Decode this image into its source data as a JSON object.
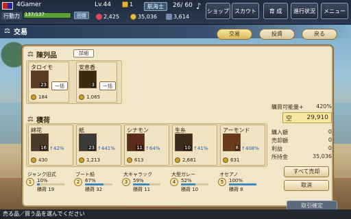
{
  "topbar": {
    "player_name": "4Gamer",
    "level": "Lv.44",
    "gift_count": "1",
    "rank_badge": "航海士",
    "slot_count": "26/ 60",
    "action_label": "行動力",
    "action_value": "137/137",
    "recover_label": "回復",
    "hearts": "2,425",
    "coins": "35,036",
    "tickets": "3,614",
    "buttons": [
      "ショップ",
      "スカウト",
      "育 成",
      "進行状況",
      "メニュー"
    ]
  },
  "section": {
    "title": "交易"
  },
  "tabs": [
    "交易",
    "投資",
    "戻る"
  ],
  "display": {
    "title": "陳列品",
    "detail_label": "詳細",
    "items": [
      {
        "name": "タロイモ",
        "qty": "23",
        "price": "184",
        "button": "一括"
      },
      {
        "name": "安息香",
        "qty": "3",
        "price": "1,065",
        "button": "一括"
      }
    ]
  },
  "cargo": {
    "title": "積荷",
    "items": [
      {
        "name": "綿花",
        "qty": "16",
        "pct": "42%",
        "price": "430"
      },
      {
        "name": "紙",
        "qty": "23",
        "pct": "441%",
        "price": "1,213"
      },
      {
        "name": "シナモン",
        "qty": "11",
        "pct": "64%",
        "price": "613"
      },
      {
        "name": "生糸",
        "qty": "10",
        "pct": "41%",
        "price": "2,681"
      },
      {
        "name": "アーモンド",
        "qty": "8",
        "pct": "408%",
        "price": "631"
      }
    ],
    "ships": [
      {
        "num": "1",
        "name": "ジャンク旧式",
        "pct": "10%",
        "pct_value": 0.1,
        "load": "積荷 19"
      },
      {
        "num": "2",
        "name": "ブート船",
        "pct": "67%",
        "pct_value": 0.67,
        "load": "積荷 32"
      },
      {
        "num": "3",
        "name": "大キャラック",
        "pct": "59%",
        "pct_value": 0.59,
        "load": "積荷 11"
      },
      {
        "num": "4",
        "name": "大型ガレー",
        "pct": "52%",
        "pct_value": 0.52,
        "load": "積荷 10"
      },
      {
        "num": "5",
        "name": "オセアノ",
        "pct": "100%",
        "pct_value": 1.0,
        "load": "積荷 8"
      }
    ]
  },
  "summary": {
    "capacity_label": "購買可能量+",
    "capacity_value": "420%",
    "capacity_icon_label": "空",
    "capacity_amount": "29,910",
    "buy_label": "購入額",
    "buy_value": "0",
    "sell_label": "売却額",
    "sell_value": "0",
    "profit_label": "利益",
    "profit_value": "0",
    "money_label": "所持金",
    "money_value": "35,036"
  },
  "actions": {
    "sell_all": "すべて売却",
    "cancel": "取消",
    "confirm": "取引確定"
  },
  "status_text": "売る品／買う品を選んでください"
}
